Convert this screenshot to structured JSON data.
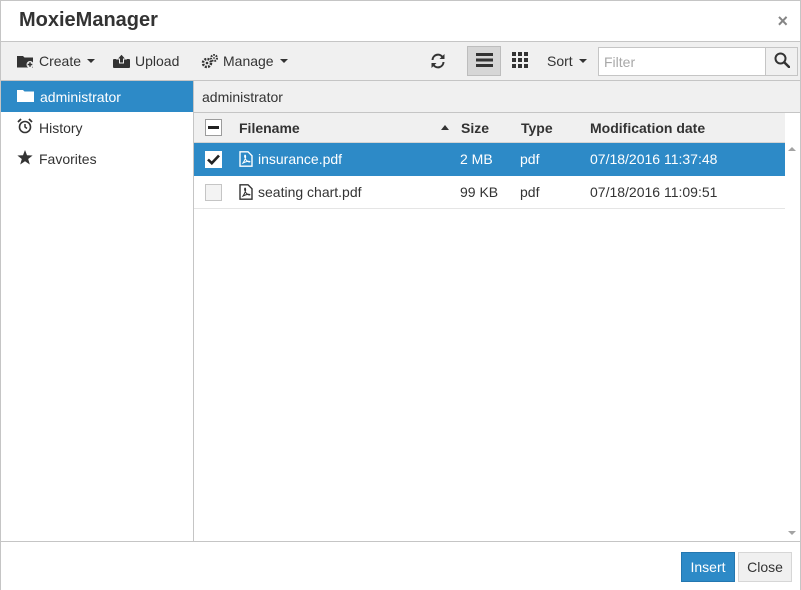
{
  "window": {
    "title": "MoxieManager",
    "close_glyph": "×"
  },
  "toolbar": {
    "create_label": "Create",
    "upload_label": "Upload",
    "manage_label": "Manage",
    "sort_label": "Sort",
    "filter_placeholder": "Filter",
    "icons": {
      "create": "folder-plus-icon",
      "upload": "upload-icon",
      "manage": "gears-icon",
      "refresh": "refresh-icon",
      "list_view": "list-view-icon",
      "thumb_view": "grid-view-icon",
      "search": "search-icon"
    },
    "active_view": "list"
  },
  "sidebar": {
    "items": [
      {
        "label": "administrator",
        "icon": "folder-icon",
        "active": true
      },
      {
        "label": "History",
        "icon": "alarm-clock-icon",
        "active": false
      },
      {
        "label": "Favorites",
        "icon": "star-icon",
        "active": false
      }
    ]
  },
  "path": {
    "current": "administrator"
  },
  "grid": {
    "columns": {
      "filename": "Filename",
      "size": "Size",
      "type": "Type",
      "modified": "Modification date"
    },
    "sort_column": "Filename",
    "sort_direction": "ascending",
    "rows": [
      {
        "filename": "insurance.pdf",
        "size": "2 MB",
        "type": "pdf",
        "modified": "07/18/2016 11:37:48",
        "selected": true,
        "icon": "pdf-file-icon"
      },
      {
        "filename": "seating chart.pdf",
        "size": "99 KB",
        "type": "pdf",
        "modified": "07/18/2016 11:09:51",
        "selected": false,
        "icon": "pdf-file-icon"
      }
    ]
  },
  "footer": {
    "insert_label": "Insert",
    "close_label": "Close"
  },
  "colors": {
    "accent": "#2d8ac7",
    "toolbar_bg": "#f0f0f0",
    "border": "#c5c5c5",
    "text": "#333333"
  }
}
